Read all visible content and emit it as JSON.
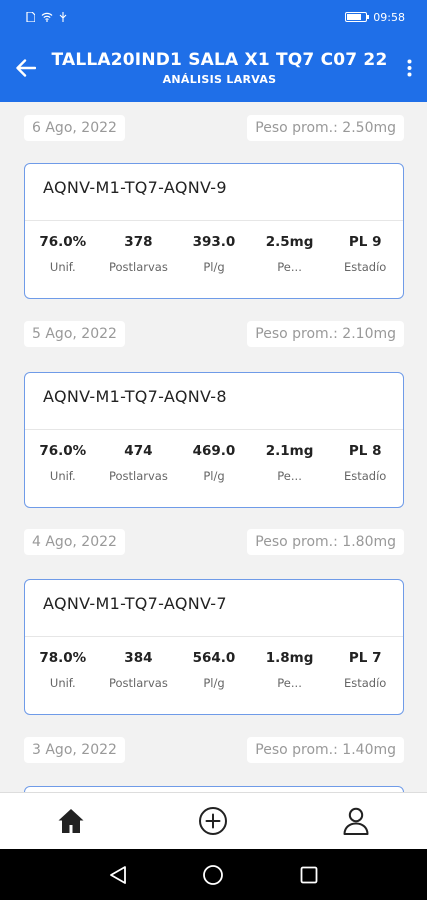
{
  "status_bar": {
    "time": "09:58"
  },
  "header": {
    "title": "TALLA20IND1 SALA X1 TQ7 C07 22",
    "subtitle": "ANÁLISIS LARVAS"
  },
  "entries": [
    {
      "date": "6 Ago, 2022",
      "avg_weight": "Peso prom.: 2.50mg",
      "card_title": "AQNV-M1-TQ7-AQNV-9",
      "stats": [
        {
          "value": "76.0%",
          "label": "Unif."
        },
        {
          "value": "378",
          "label": "Postlarvas"
        },
        {
          "value": "393.0",
          "label": "Pl/g"
        },
        {
          "value": "2.5mg",
          "label": "Pe..."
        },
        {
          "value": "PL 9",
          "label": "Estadío"
        }
      ]
    },
    {
      "date": "5 Ago, 2022",
      "avg_weight": "Peso prom.: 2.10mg",
      "card_title": "AQNV-M1-TQ7-AQNV-8",
      "stats": [
        {
          "value": "76.0%",
          "label": "Unif."
        },
        {
          "value": "474",
          "label": "Postlarvas"
        },
        {
          "value": "469.0",
          "label": "Pl/g"
        },
        {
          "value": "2.1mg",
          "label": "Pe..."
        },
        {
          "value": "PL 8",
          "label": "Estadío"
        }
      ]
    },
    {
      "date": "4 Ago, 2022",
      "avg_weight": "Peso prom.: 1.80mg",
      "card_title": "AQNV-M1-TQ7-AQNV-7",
      "stats": [
        {
          "value": "78.0%",
          "label": "Unif."
        },
        {
          "value": "384",
          "label": "Postlarvas"
        },
        {
          "value": "564.0",
          "label": "Pl/g"
        },
        {
          "value": "1.8mg",
          "label": "Pe..."
        },
        {
          "value": "PL 7",
          "label": "Estadío"
        }
      ]
    },
    {
      "date": "3 Ago, 2022",
      "avg_weight": "Peso prom.: 1.40mg"
    }
  ],
  "bottom_nav": [
    "home-icon",
    "add-circle-icon",
    "profile-icon"
  ],
  "system_nav": [
    "back-triangle-icon",
    "home-circle-icon",
    "recents-square-icon"
  ],
  "colors": {
    "primary": "#1f6fe8",
    "card_border": "#6f9be8",
    "background": "#f2f2f2"
  }
}
